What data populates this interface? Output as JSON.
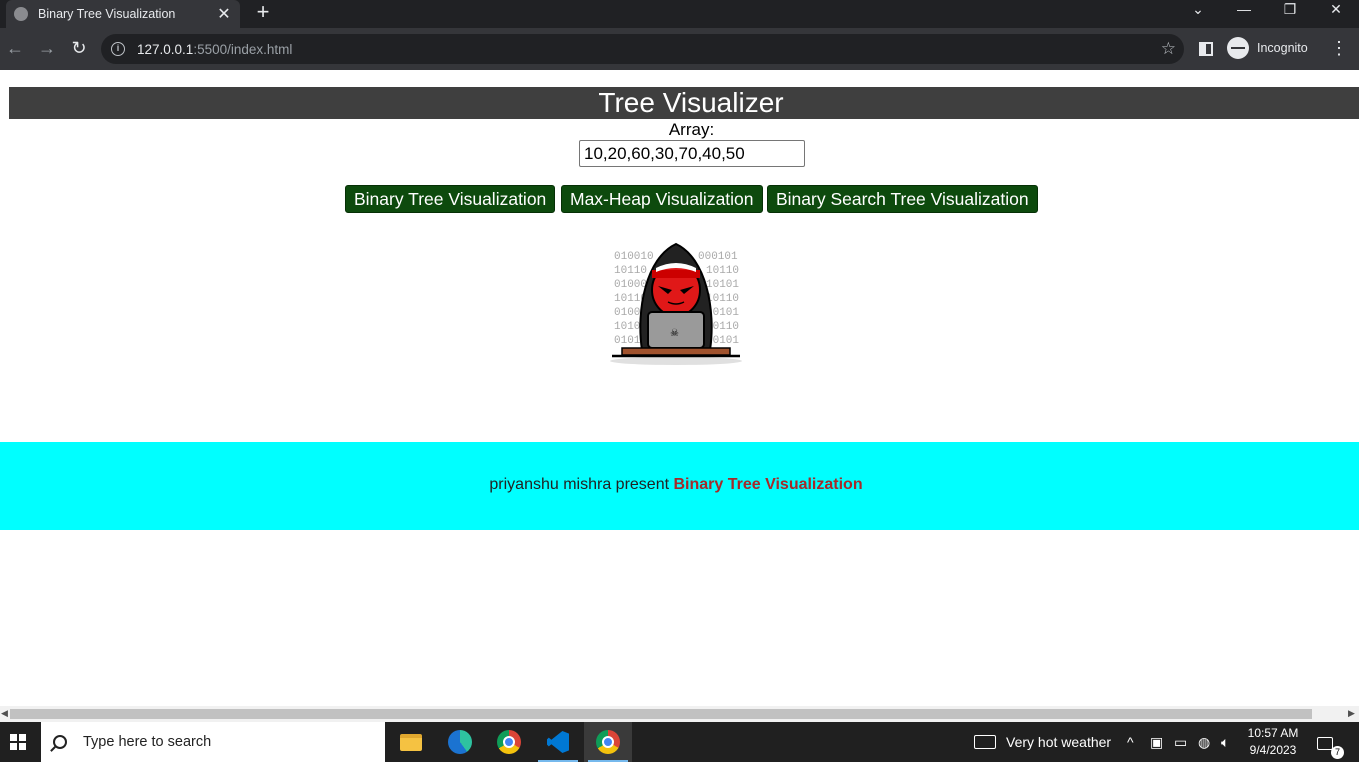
{
  "browser": {
    "tab_title": "Binary Tree Visualization",
    "tab_close": "✕",
    "new_tab": "+",
    "url_host": "127.0.0.1",
    "url_path": ":5500/index.html",
    "profile_label": "Incognito",
    "window_controls": {
      "minimize": "—",
      "restore": "❐",
      "close": "✕",
      "tab_search": "⌄"
    },
    "nav": {
      "back": "←",
      "forward": "→",
      "reload": "↻",
      "star": "☆",
      "menu": "⋮"
    }
  },
  "page": {
    "header_title": "Tree Visualizer",
    "array_label": "Array:",
    "array_value": "10,20,60,30,70,40,50",
    "buttons": [
      "Binary Tree Visualization",
      "Max-Heap Visualization",
      "Binary Search Tree Visualization"
    ],
    "image_binary_left": [
      "010010",
      "10110",
      "01000",
      "10110",
      "01001",
      "10101",
      "01010"
    ],
    "image_binary_right": [
      "000101",
      "10110",
      "10101",
      "10110",
      "10101",
      "10110",
      "10101"
    ],
    "footer_prefix": "priyanshu mishra present",
    "footer_brand": "Binary Tree Visualization",
    "colors": {
      "header_bg": "#3f3f3f",
      "button_bg": "#0d4a0d",
      "footer_bg": "#00ffff",
      "brand": "#a52a2a"
    }
  },
  "taskbar": {
    "search_placeholder": "Type here to search",
    "apps": [
      "file-explorer",
      "edge",
      "chrome",
      "vscode",
      "chrome-incognito"
    ],
    "weather": "Very hot weather",
    "time": "10:57 AM",
    "date": "9/4/2023",
    "notification_count": "7"
  }
}
